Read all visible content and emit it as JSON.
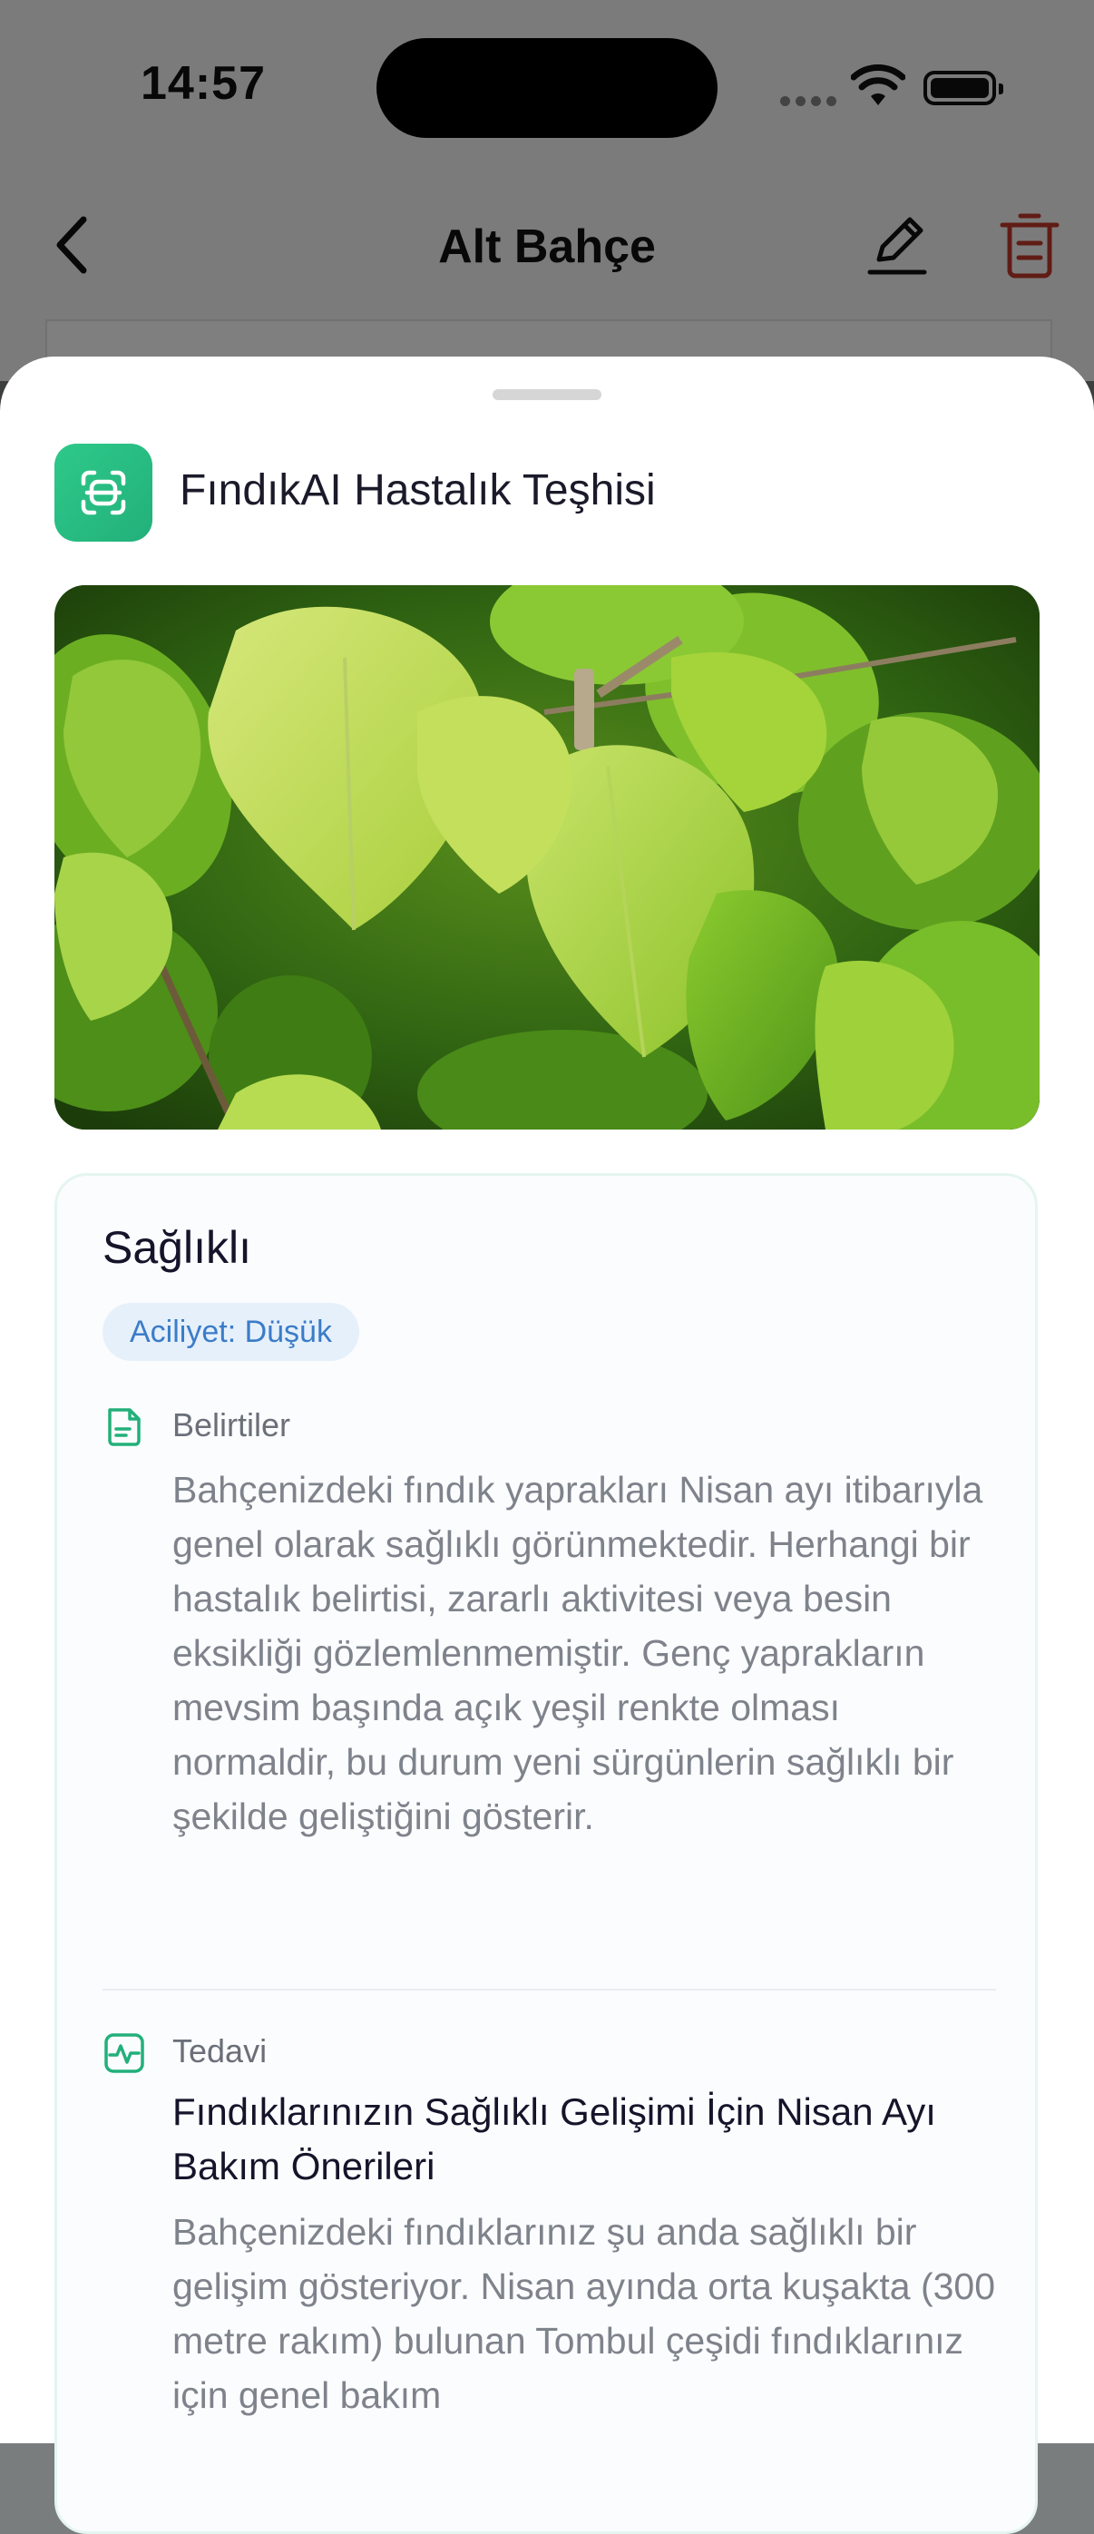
{
  "status_bar": {
    "time": "14:57"
  },
  "nav": {
    "title": "Alt Bahçe"
  },
  "sheet": {
    "title": "FındıkAI Hastalık Teşhisi",
    "photo_alt": "Fındık yaprakları"
  },
  "result": {
    "status": "Sağlıklı",
    "urgency": "Aciliyet: Düşük",
    "symptoms": {
      "label": "Belirtiler",
      "text": "Bahçenizdeki fındık yaprakları Nisan ayı itibarıyla genel olarak sağlıklı görünmektedir. Herhangi bir hastalık belirtisi, zararlı aktivitesi veya besin eksikliği gözlemlenmemiştir. Genç yaprakların mevsim başında açık yeşil renkte olması normaldir, bu durum yeni sürgünlerin sağlıklı bir şekilde geliştiğini gösterir."
    },
    "treatment": {
      "label": "Tedavi",
      "title": "Fındıklarınızın Sağlıklı Gelişimi İçin Nisan Ayı Bakım Önerileri",
      "text": "Bahçenizdeki fındıklarınız şu anda sağlıklı bir gelişim gösteriyor. Nisan ayında orta kuşakta (300 metre rakım) bulunan Tombul çeşidi fındıklarınız için genel bakım"
    }
  },
  "colors": {
    "accent_green": "#22b07a",
    "urgency_bg": "#e6f0fb",
    "urgency_text": "#3b7cc8",
    "delete_red": "#c0392b"
  },
  "icons": [
    "back-chevron-icon",
    "edit-pencil-icon",
    "trash-icon",
    "scan-icon",
    "document-icon",
    "pulse-icon"
  ]
}
